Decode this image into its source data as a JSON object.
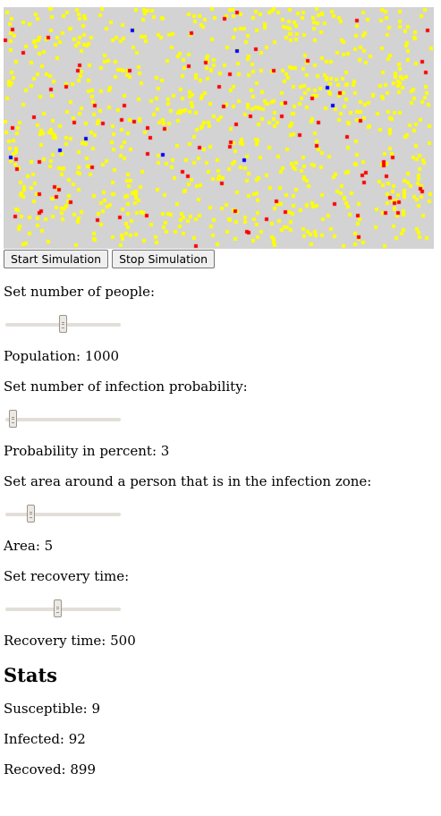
{
  "simulation": {
    "colors": {
      "background": "#d3d3d3",
      "susceptible": "#0000ff",
      "infected": "#ff0000",
      "recovered": "#ffff00"
    },
    "counts": {
      "susceptible": 9,
      "infected": 92,
      "recovered": 899
    }
  },
  "controls": {
    "start_label": "Start Simulation",
    "stop_label": "Stop Simulation"
  },
  "settings": [
    {
      "prompt": "Set number of people:",
      "value_text": "Population: 1000",
      "slider_fraction": 0.5
    },
    {
      "prompt": "Set number of infection probability:",
      "value_text": "Probability in percent: 3",
      "slider_fraction": 0.03
    },
    {
      "prompt": "Set area around a person that is in the infection zone:",
      "value_text": "Area: 5",
      "slider_fraction": 0.2
    },
    {
      "prompt": "Set recovery time:",
      "value_text": "Recovery time: 500",
      "slider_fraction": 0.45
    }
  ],
  "stats": {
    "heading": "Stats",
    "susceptible": "Susceptible: 9",
    "infected": "Infected: 92",
    "recovered": "Recoved: 899"
  }
}
